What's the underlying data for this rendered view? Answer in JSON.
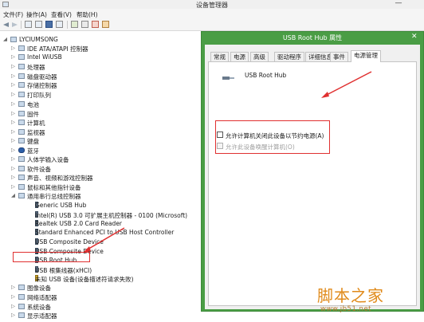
{
  "window": {
    "title": "设备管理器",
    "minimize_glyph": "—"
  },
  "menu": [
    {
      "label": "文件(F)"
    },
    {
      "label": "操作(A)"
    },
    {
      "label": "查看(V)"
    },
    {
      "label": "帮助(H)"
    }
  ],
  "toolbar_icons": [
    "back-icon",
    "forward-icon",
    "properties-icon",
    "update-icon",
    "help-icon",
    "monitor-icon",
    "scan-icon",
    "driver-icon",
    "disable-icon",
    "uninstall-icon"
  ],
  "tree": {
    "root": "LYCIUMSONG",
    "categories": [
      {
        "label": "IDE ATA/ATAPI 控制器",
        "icon": "disk-controller-icon"
      },
      {
        "label": "Intel WiUSB",
        "icon": "network-icon"
      },
      {
        "label": "处理器",
        "icon": "processor-icon"
      },
      {
        "label": "磁盘驱动器",
        "icon": "disk-icon"
      },
      {
        "label": "存储控制器",
        "icon": "storage-icon"
      },
      {
        "label": "打印队列",
        "icon": "printer-icon"
      },
      {
        "label": "电池",
        "icon": "battery-icon"
      },
      {
        "label": "固件",
        "icon": "firmware-icon"
      },
      {
        "label": "计算机",
        "icon": "computer-icon"
      },
      {
        "label": "监视器",
        "icon": "monitor-icon"
      },
      {
        "label": "键盘",
        "icon": "keyboard-icon"
      },
      {
        "label": "蓝牙",
        "icon": "bluetooth-icon"
      },
      {
        "label": "人体学输入设备",
        "icon": "hid-icon"
      },
      {
        "label": "软件设备",
        "icon": "software-icon"
      },
      {
        "label": "声音、视频和游戏控制器",
        "icon": "sound-icon"
      },
      {
        "label": "鼠标和其他指针设备",
        "icon": "mouse-icon"
      },
      {
        "label": "通用串行总线控制器",
        "icon": "usb-controller-icon",
        "expanded": true
      }
    ],
    "usb_children": [
      {
        "label": "Generic USB Hub"
      },
      {
        "label": "Intel(R) USB 3.0 可扩展主机控制器 - 0100 (Microsoft)"
      },
      {
        "label": "Realtek USB 2.0 Card Reader"
      },
      {
        "label": "Standard Enhanced PCI to USB Host Controller"
      },
      {
        "label": "USB Composite Device"
      },
      {
        "label": "USB Composite Device"
      },
      {
        "label": "USB Root Hub",
        "highlighted": true
      },
      {
        "label": "USB 根集线器(xHCI)"
      },
      {
        "label": "未知 USB 设备(设备描述符请求失败)"
      }
    ],
    "after": [
      {
        "label": "图像设备",
        "icon": "camera-icon"
      },
      {
        "label": "网络适配器",
        "icon": "network-adapter-icon"
      },
      {
        "label": "系统设备",
        "icon": "system-icon"
      },
      {
        "label": "显示适配器",
        "icon": "display-adapter-icon"
      }
    ]
  },
  "dialog": {
    "title": "USB Root Hub 属性",
    "close_glyph": "✕",
    "tabs": [
      {
        "label": "常规"
      },
      {
        "label": "电源"
      },
      {
        "label": "高级"
      },
      {
        "label": "驱动程序"
      },
      {
        "label": "详细信息"
      },
      {
        "label": "事件"
      },
      {
        "label": "电源管理",
        "active": true
      }
    ],
    "device_name": "USB Root Hub",
    "options": [
      {
        "label": "允许计算机关闭此设备以节约电源(A)",
        "checked": false,
        "enabled": true
      },
      {
        "label": "允许此设备唤醒计算机(O)",
        "checked": false,
        "enabled": false
      }
    ]
  },
  "watermark": {
    "title": "脚本之家",
    "url": "www.jb51.net"
  },
  "colors": {
    "dialog_frame": "#4a9d45",
    "annotation_red": "#e03030",
    "watermark_orange": "#e08a1a"
  }
}
